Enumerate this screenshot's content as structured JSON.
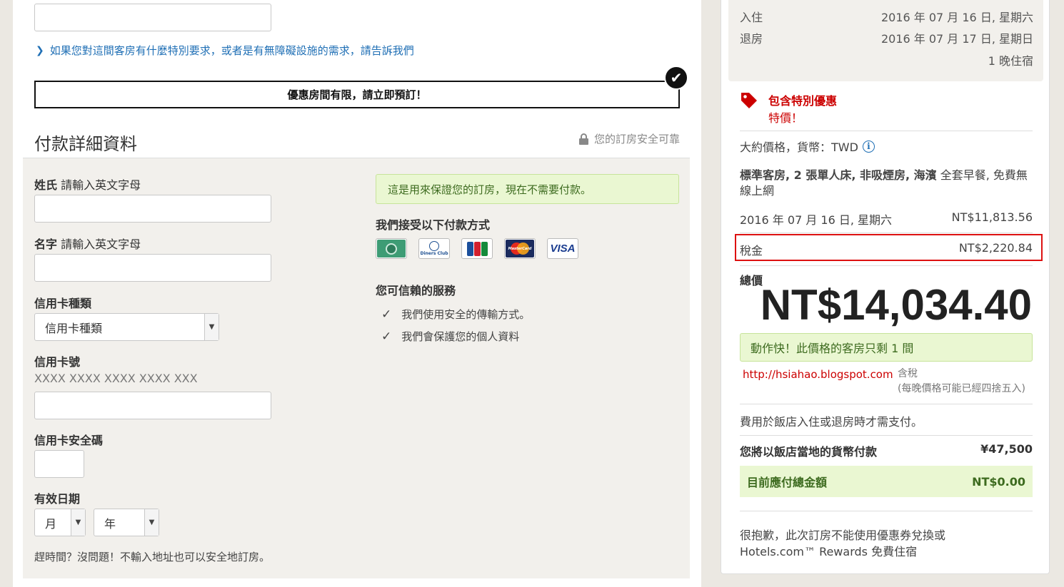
{
  "special_request_link": "如果您對這間客房有什麼特別要求，或者是有無障礙設施的需求，請告訴我們",
  "promo_banner": "優惠房間有限，請立即預訂！",
  "payment": {
    "title": "付款詳細資料",
    "secure_note": "您的訂房安全可靠",
    "surname_label": "姓氏",
    "surname_hint": "請輸入英文字母",
    "given_name_label": "名字",
    "given_name_hint": "請輸入英文字母",
    "card_type_label": "信用卡種類",
    "card_type_selected": "信用卡種類",
    "card_number_label": "信用卡號",
    "card_number_format": "XXXX XXXX XXXX XXXX XXX",
    "cvv_label": "信用卡安全碼",
    "expiry_label": "有效日期",
    "expiry_month": "月",
    "expiry_year": "年",
    "footnote": "趕時間？沒問題！不輸入地址也可以安全地訂房。",
    "guarantee_note": "這是用來保證您的訂房，現在不需要付款。",
    "accepted_title": "我們接受以下付款方式",
    "cards": [
      "amex-card-icon",
      "diners-club-card-icon",
      "jcb-card-icon",
      "mastercard-card-icon",
      "visa-card-icon"
    ],
    "card_labels": {
      "diners": "Diners Club",
      "jcb": "JCB",
      "mastercard": "MasterCard",
      "visa": "VISA"
    },
    "trust_title": "您可信賴的服務",
    "trust_items": [
      "我們使用安全的傳輸方式。",
      "我們會保護您的個人資料"
    ]
  },
  "summary": {
    "checkin_label": "入住",
    "checkin_date": "2016 年 07 月 16 日, 星期六",
    "checkout_label": "退房",
    "checkout_date": "2016 年 07 月 17 日, 星期日",
    "nights": "1 晚住宿",
    "special_title": "包含特別優惠",
    "special_sub": "特價！",
    "currency_note": "大約價格，貨幣：TWD",
    "room_desc_bold": "標準客房, 2 張單人床, 非吸煙房, 海濱",
    "room_desc_rest": " 全套早餐, 免費無線上網",
    "night_date": "2016 年 07 月 16 日, 星期六",
    "night_price": "NT$11,813.56",
    "tax_label": "稅金",
    "tax_value": "NT$2,220.84",
    "total_label": "總價",
    "total_value": "NT$14,034.40",
    "hurry_note": "動作快！此價格的客房只剩 1 間",
    "blog_url": "http://hsiahao.blogspot.com",
    "tax_included": "含稅",
    "rounding_note": "(每晚價格可能已經四捨五入)",
    "pay_at_hotel": "費用於飯店入住或退房時才需支付。",
    "local_currency_label": "您將以飯店當地的貨幣付款",
    "local_currency_value": "¥47,500",
    "due_now_label": "目前應付總金額",
    "due_now_value": "NT$0.00",
    "sorry_line1": "很抱歉，此次訂房不能使用優惠券兌換或",
    "sorry_line2": "Hotels.com™ Rewards 免費住宿"
  },
  "colors": {
    "accent_red": "#cc0000",
    "link_blue": "#1f6fb5",
    "success_bg": "#eaf7d2",
    "success_text": "#3d6b1f"
  }
}
